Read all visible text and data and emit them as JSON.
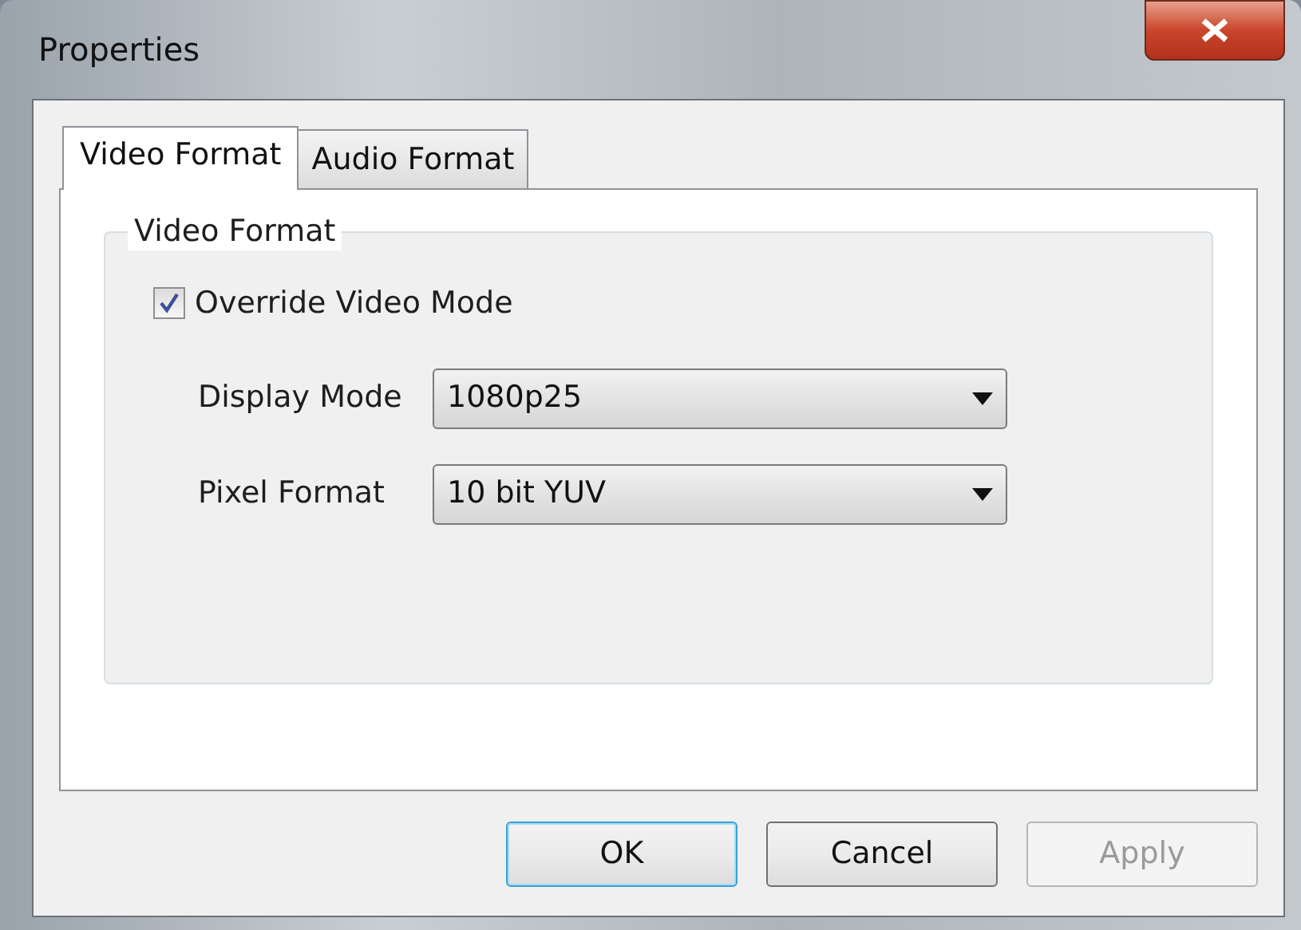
{
  "window": {
    "title": "Properties"
  },
  "tabs": [
    {
      "label": "Video Format",
      "selected": true
    },
    {
      "label": "Audio Format",
      "selected": false
    }
  ],
  "group": {
    "title": "Video Format",
    "checkbox": {
      "label": "Override Video Mode",
      "checked": true
    },
    "fields": [
      {
        "label": "Display Mode",
        "value": "1080p25"
      },
      {
        "label": "Pixel Format",
        "value": "10 bit YUV"
      }
    ]
  },
  "buttons": [
    {
      "label": "OK",
      "default": true,
      "disabled": false
    },
    {
      "label": "Cancel",
      "default": false,
      "disabled": false
    },
    {
      "label": "Apply",
      "default": false,
      "disabled": true
    }
  ]
}
